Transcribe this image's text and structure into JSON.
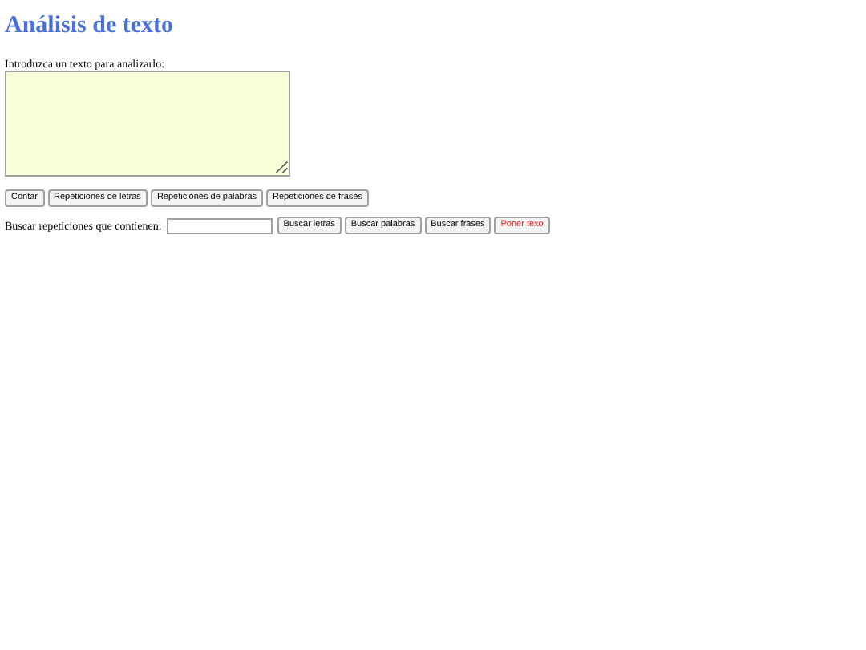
{
  "title": "Análisis de texto",
  "input": {
    "label": "Introduzca un texto para analizarlo:"
  },
  "count_buttons": [
    {
      "label": "Contar",
      "kind": "normal"
    },
    {
      "label": "Repeticiones de letras",
      "kind": "normal"
    },
    {
      "label": "Repeticiones de palabras",
      "kind": "normal"
    },
    {
      "label": "Repeticiones de frases",
      "kind": "normal"
    }
  ],
  "search": {
    "label": "Buscar repeticiones que contienen:"
  },
  "search_buttons": [
    {
      "label": "Buscar letras",
      "kind": "normal"
    },
    {
      "label": "Buscar palabras",
      "kind": "normal"
    },
    {
      "label": "Buscar frases",
      "kind": "normal"
    },
    {
      "label": "Poner texo",
      "kind": "warning"
    }
  ]
}
